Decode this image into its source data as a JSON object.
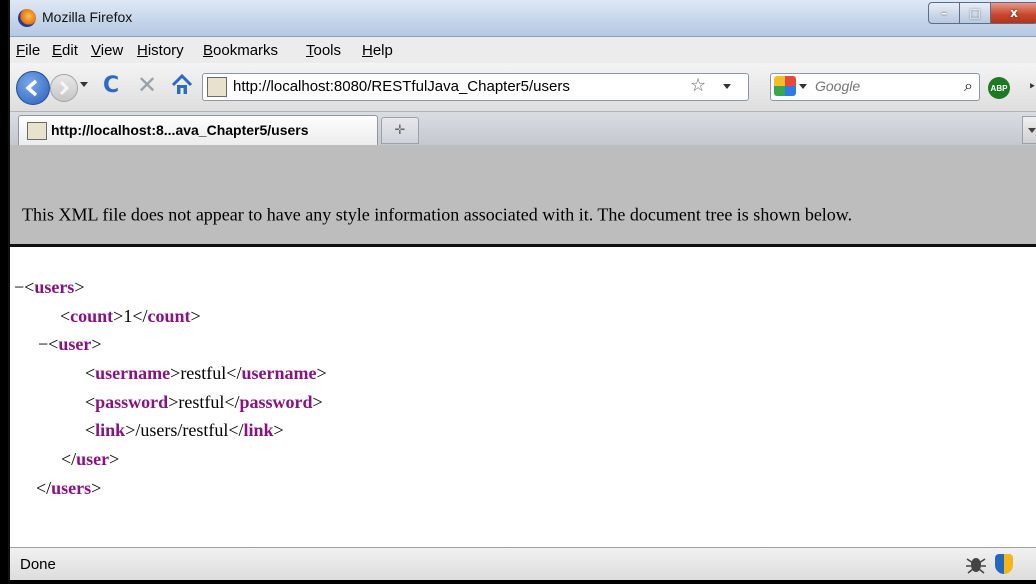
{
  "window": {
    "title": "Mozilla Firefox",
    "minimize_glyph": "–",
    "maximize_glyph": "□",
    "close_glyph": "x"
  },
  "menubar": {
    "items": [
      "File",
      "Edit",
      "View",
      "History",
      "Bookmarks",
      "Tools",
      "Help"
    ]
  },
  "navbar": {
    "url": "http://localhost:8080/RESTfulJava_Chapter5/users",
    "search_placeholder": "Google",
    "abp_label": "ABP",
    "reload_glyph": "C",
    "stop_glyph": "✕",
    "star_glyph": "☆",
    "search_glyph": "⌕",
    "overflow_glyph": "‣"
  },
  "tabs": {
    "active_label": "http://localhost:8...ava_Chapter5/users",
    "newtab_glyph": "✛"
  },
  "notice": {
    "text": "This XML file does not appear to have any style information associated with it. The document tree is shown below."
  },
  "tree": {
    "collapser": "−",
    "root_tag": "users",
    "count_tag": "count",
    "count_value": "1",
    "user_tag": "user",
    "username_tag": "username",
    "username_value": "restful",
    "password_tag": "password",
    "password_value": "restful",
    "link_tag": "link",
    "link_value": "/users/restful"
  },
  "statusbar": {
    "text": "Done"
  },
  "colors": {
    "tag": "#881280",
    "notice_bg": "#bdbdbd",
    "close_button": "#c7452b"
  },
  "icons": [
    "firefox-icon",
    "back-arrow-icon",
    "forward-arrow-icon",
    "reload-icon",
    "stop-icon",
    "home-icon",
    "page-favicon",
    "bookmark-star-icon",
    "google-icon",
    "search-icon",
    "adblock-plus-icon",
    "bug-icon",
    "shield-icon"
  ]
}
